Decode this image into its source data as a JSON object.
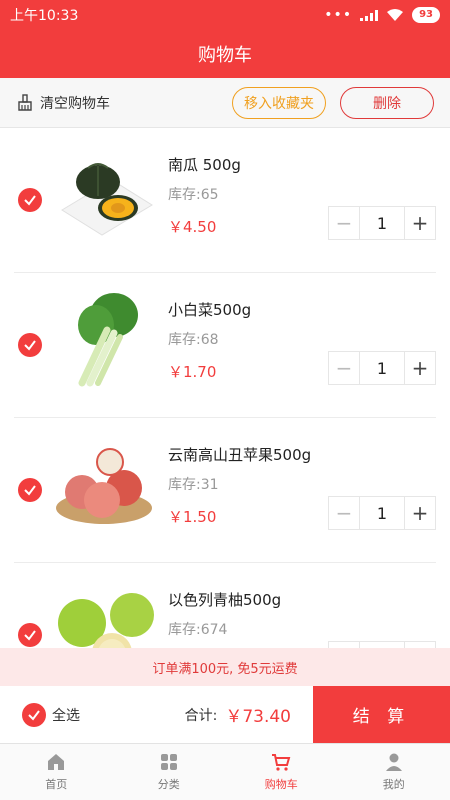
{
  "status_bar": {
    "time": "上午10:33",
    "battery": "93"
  },
  "header": {
    "title": "购物车"
  },
  "toolbar": {
    "clear_label": "清空购物车",
    "favorite_label": "移入收藏夹",
    "delete_label": "删除"
  },
  "items": [
    {
      "name": "南瓜 500g",
      "stock": "库存:65",
      "price": "￥4.50",
      "qty": "1"
    },
    {
      "name": "小白菜500g",
      "stock": "库存:68",
      "price": "￥1.70",
      "qty": "1"
    },
    {
      "name": "云南高山丑苹果500g",
      "stock": "库存:31",
      "price": "￥1.50",
      "qty": "1"
    },
    {
      "name": "以色列青柚500g",
      "stock": "库存:674",
      "price": "",
      "qty": ""
    }
  ],
  "promo": "订单满100元, 免5元运费",
  "summary": {
    "select_all_label": "全选",
    "total_label": "合计:",
    "total_value": "￥73.40",
    "checkout_label": "结 算"
  },
  "tabs": [
    {
      "label": "首页",
      "icon": "home-icon"
    },
    {
      "label": "分类",
      "icon": "grid-icon"
    },
    {
      "label": "购物车",
      "icon": "cart-icon",
      "active": true
    },
    {
      "label": "我的",
      "icon": "user-icon"
    }
  ],
  "colors": {
    "brand": "#f23d3d",
    "favorite": "#f0a020"
  }
}
